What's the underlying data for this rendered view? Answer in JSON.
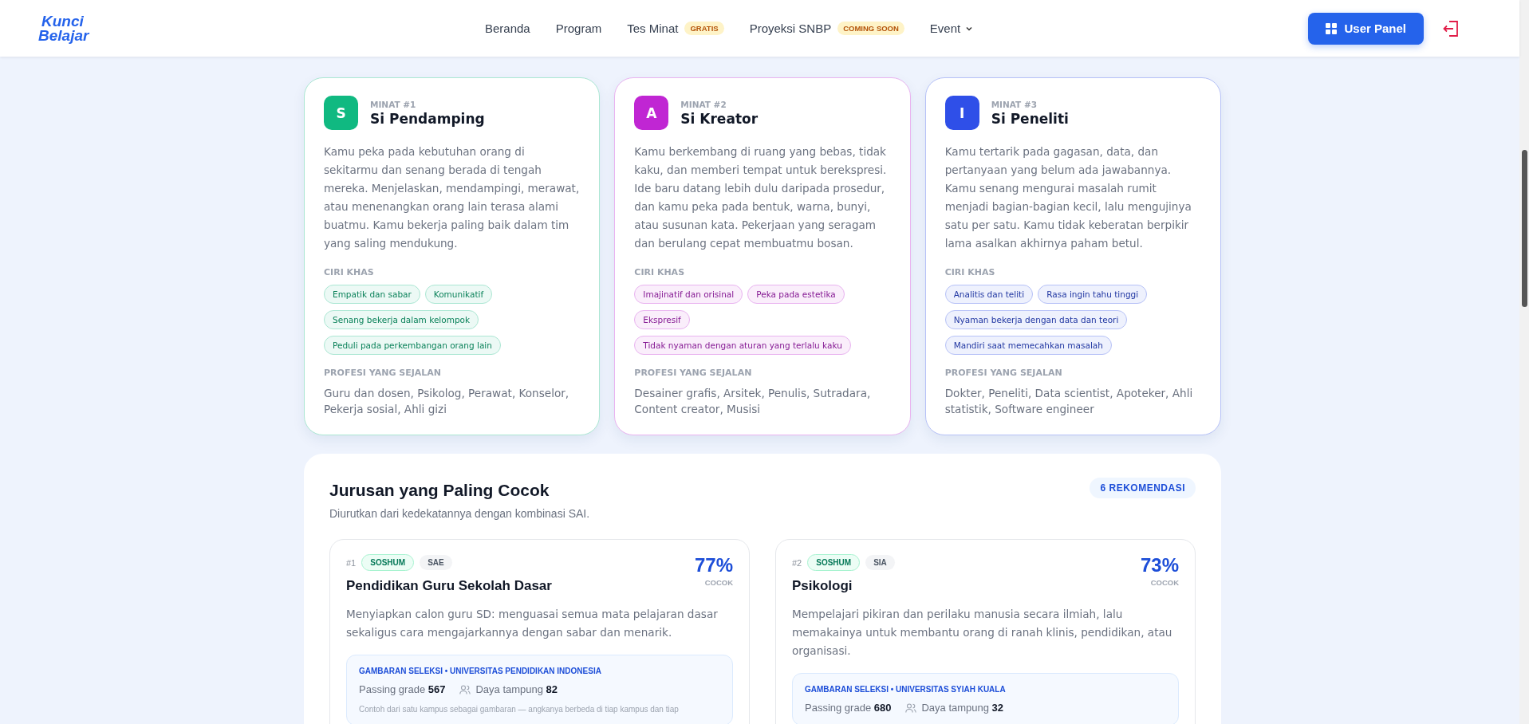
{
  "header": {
    "logo": [
      "Kunci",
      "Belajar"
    ],
    "nav": [
      {
        "label": "Beranda",
        "dropdown": false
      },
      {
        "label": "Program",
        "dropdown": false
      },
      {
        "label": "Tes Minat",
        "badge": "GRATIS",
        "dropdown": false
      },
      {
        "label": "Proyeksi SNBP",
        "badge": "COMING SOON",
        "dropdown": false
      },
      {
        "label": "Event",
        "dropdown": true
      }
    ],
    "user_panel_button": "User Panel"
  },
  "interests": [
    {
      "rank": "MINAT #1",
      "letter": "S",
      "name": "Si Pendamping",
      "color": "#10b981",
      "description": "Kamu peka pada kebutuhan orang di sekitarmu dan senang berada di tengah mereka. Menjelaskan, mendampingi, merawat, atau menenangkan orang lain terasa alami buatmu. Kamu bekerja paling baik dalam tim yang saling mendukung.",
      "traits_label": "CIRI KHAS",
      "traits": [
        "Empatik dan sabar",
        "Komunikatif",
        "Senang bekerja dalam kelompok",
        "Peduli pada perkembangan orang lain"
      ],
      "careers_label": "PROFESI YANG SEJALAN",
      "careers": "Guru dan dosen, Psikolog, Perawat, Konselor, Pekerja sosial, Ahli gizi"
    },
    {
      "rank": "MINAT #2",
      "letter": "A",
      "name": "Si Kreator",
      "color": "#c026d3",
      "description": "Kamu berkembang di ruang yang bebas, tidak kaku, dan memberi tempat untuk berekspresi. Ide baru datang lebih dulu daripada prosedur, dan kamu peka pada bentuk, warna, bunyi, atau susunan kata. Pekerjaan yang seragam dan berulang cepat membuatmu bosan.",
      "traits_label": "CIRI KHAS",
      "traits": [
        "Imajinatif dan orisinal",
        "Peka pada estetika",
        "Ekspresif",
        "Tidak nyaman dengan aturan yang terlalu kaku"
      ],
      "careers_label": "PROFESI YANG SEJALAN",
      "careers": "Desainer grafis, Arsitek, Penulis, Sutradara, Content creator, Musisi"
    },
    {
      "rank": "MINAT #3",
      "letter": "I",
      "name": "Si Peneliti",
      "color": "#2f4fe8",
      "description": "Kamu tertarik pada gagasan, data, dan pertanyaan yang belum ada jawabannya. Kamu senang mengurai masalah rumit menjadi bagian-bagian kecil, lalu mengujinya satu per satu. Kamu tidak keberatan berpikir lama asalkan akhirnya paham betul.",
      "traits_label": "CIRI KHAS",
      "traits": [
        "Analitis dan teliti",
        "Rasa ingin tahu tinggi",
        "Nyaman bekerja dengan data dan teori",
        "Mandiri saat memecahkan masalah"
      ],
      "careers_label": "PROFESI YANG SEJALAN",
      "careers": "Dokter, Peneliti, Data scientist, Apoteker, Ahli statistik, Software engineer"
    }
  ],
  "majors_section": {
    "title": "Jurusan yang Paling Cocok",
    "subtitle": "Diurutkan dari kedekatannya dengan kombinasi SAI.",
    "count_badge": "6 REKOMENDASI",
    "majors": [
      {
        "number": "#1",
        "cluster": "SOSHUM",
        "code": "SAE",
        "name": "Pendidikan Guru Sekolah Dasar",
        "match": "77%",
        "match_label": "COCOK",
        "description": "Menyiapkan calon guru SD: menguasai semua mata pelajaran dasar sekaligus cara mengajarkannya dengan sabar dan menarik.",
        "selection_title": "GAMBARAN SELEKSI • UNIVERSITAS PENDIDIKAN INDONESIA",
        "passing_label": "Passing grade",
        "passing": "567",
        "capacity_label": "Daya tampung",
        "capacity": "82",
        "note": "Contoh dari satu kampus sebagai gambaran — angkanya berbeda di tiap kampus dan tiap"
      },
      {
        "number": "#2",
        "cluster": "SOSHUM",
        "code": "SIA",
        "name": "Psikologi",
        "match": "73%",
        "match_label": "COCOK",
        "description": "Mempelajari pikiran dan perilaku manusia secara ilmiah, lalu memakainya untuk membantu orang di ranah klinis, pendidikan, atau organisasi.",
        "selection_title": "GAMBARAN SELEKSI • UNIVERSITAS SYIAH KUALA",
        "passing_label": "Passing grade",
        "passing": "680",
        "capacity_label": "Daya tampung",
        "capacity": "32"
      }
    ]
  }
}
